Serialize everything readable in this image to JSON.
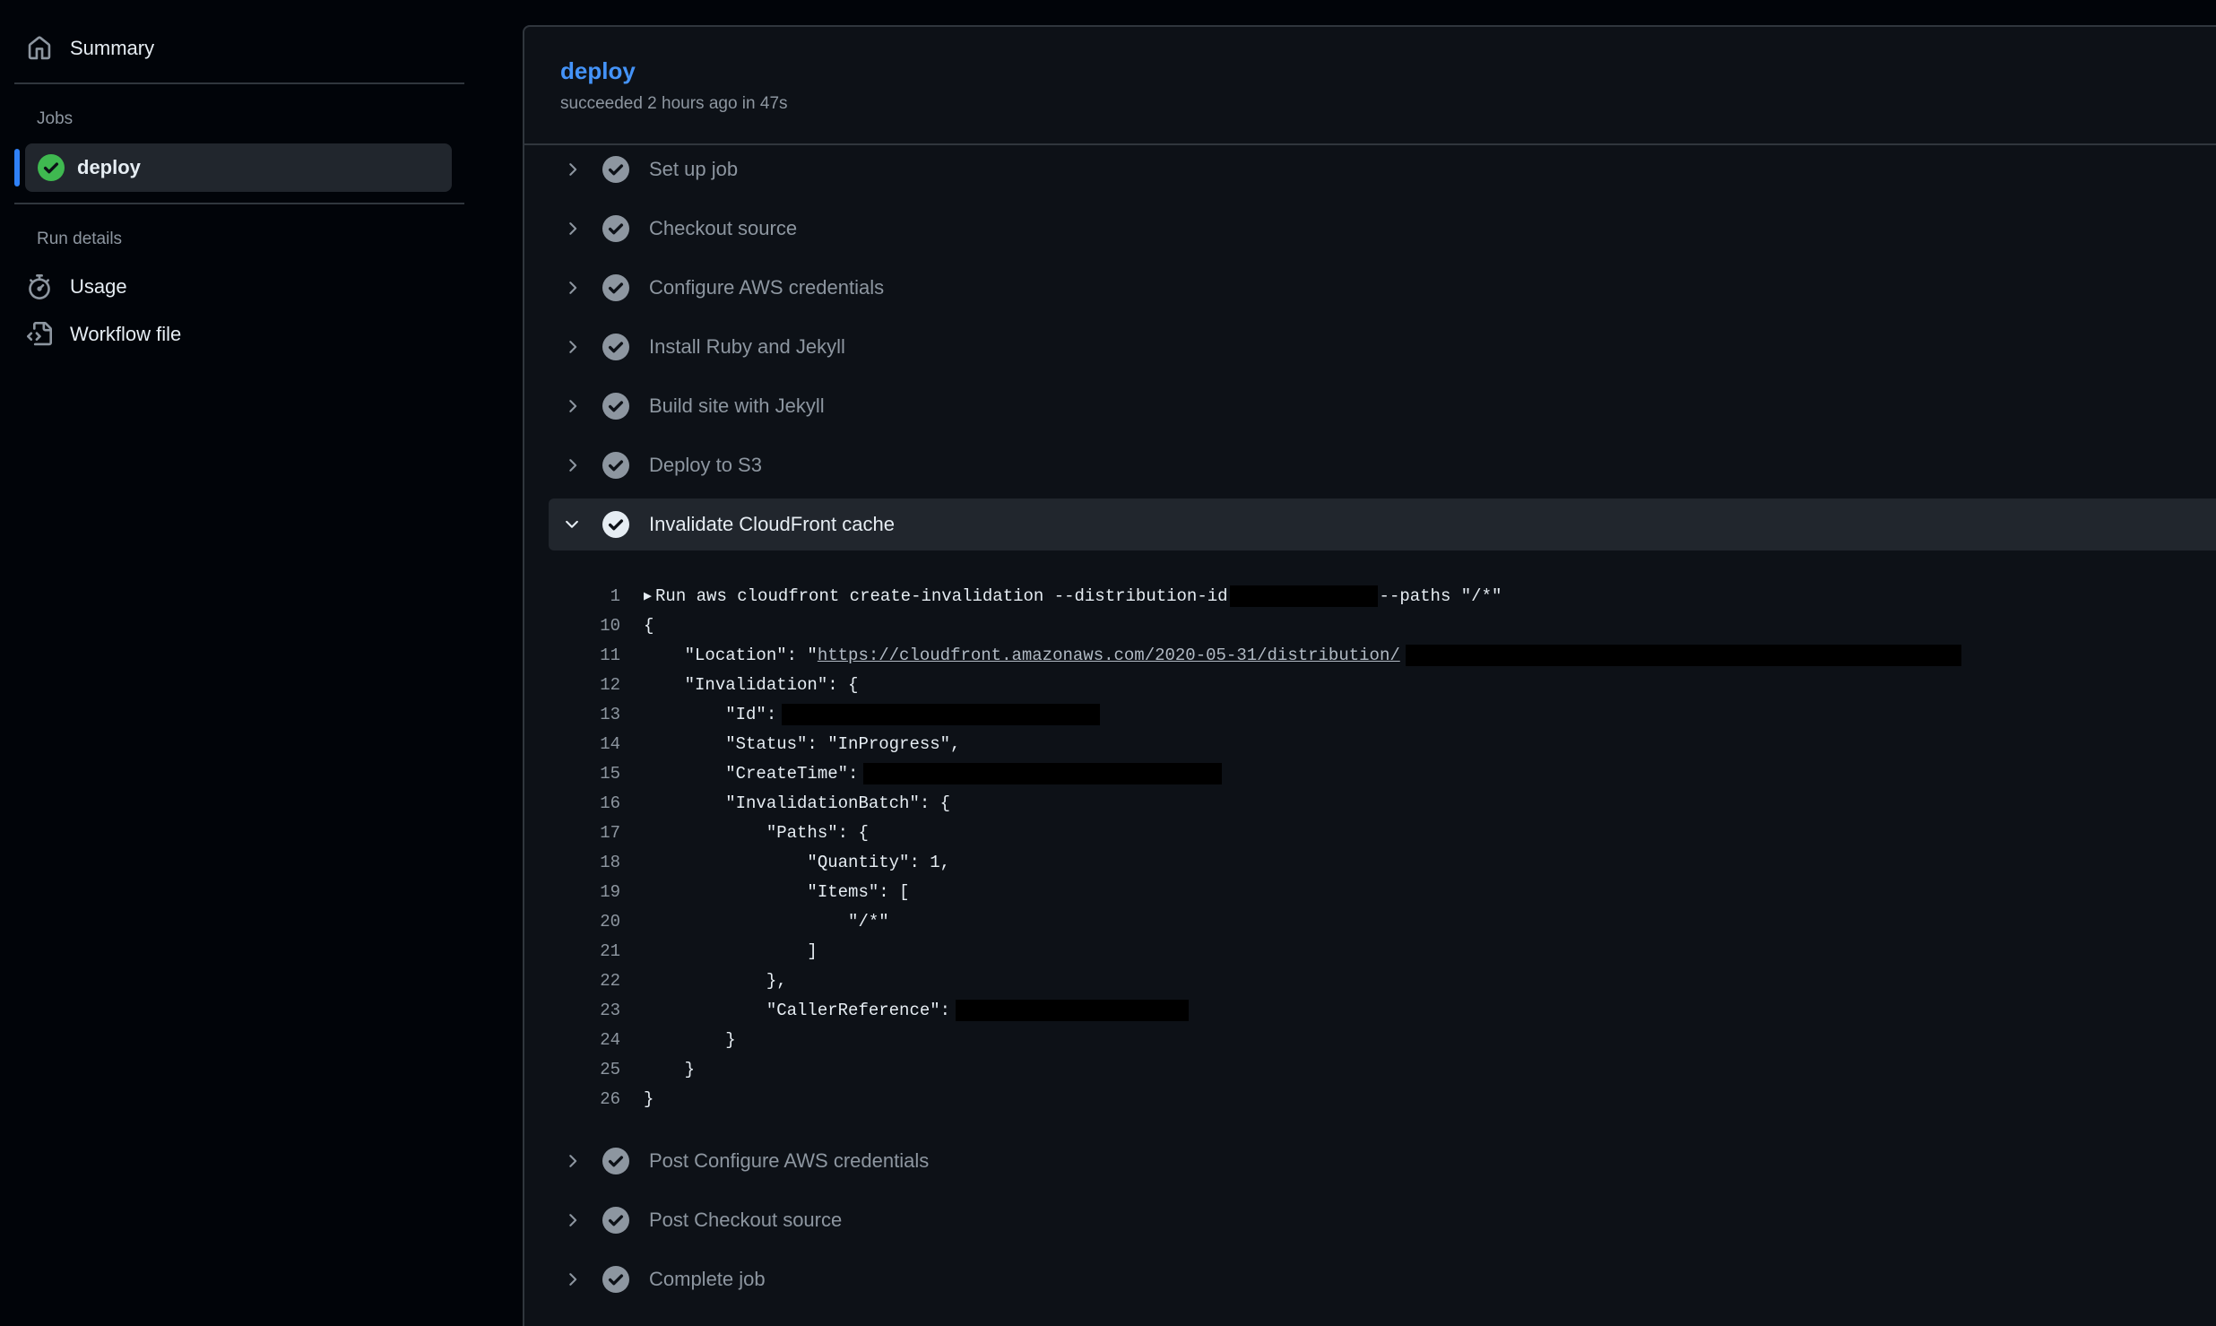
{
  "sidebar": {
    "summary_label": "Summary",
    "jobs_heading": "Jobs",
    "active_job_label": "deploy",
    "run_details_heading": "Run details",
    "usage_label": "Usage",
    "workflow_file_label": "Workflow file"
  },
  "job": {
    "title": "deploy",
    "meta": "succeeded 2 hours ago in 47s"
  },
  "steps": [
    {
      "label": "Set up job",
      "expanded": false
    },
    {
      "label": "Checkout source",
      "expanded": false
    },
    {
      "label": "Configure AWS credentials",
      "expanded": false
    },
    {
      "label": "Install Ruby and Jekyll",
      "expanded": false
    },
    {
      "label": "Build site with Jekyll",
      "expanded": false
    },
    {
      "label": "Deploy to S3",
      "expanded": false
    },
    {
      "label": "Invalidate CloudFront cache",
      "expanded": true
    },
    {
      "label": "Post Configure AWS credentials",
      "expanded": false
    },
    {
      "label": "Post Checkout source",
      "expanded": false
    },
    {
      "label": "Complete job",
      "expanded": false
    }
  ],
  "log": {
    "run_line": {
      "num": "1",
      "cmd": "Run aws cloudfront create-invalidation --distribution-id",
      "suffix": "--paths \"/*\""
    },
    "lines": [
      {
        "num": "10",
        "text": "{"
      },
      {
        "num": "11",
        "text": "    \"Location\": \"",
        "url": "https://cloudfront.amazonaws.com/2020-05-31/distribution/"
      },
      {
        "num": "12",
        "text": "    \"Invalidation\": {"
      },
      {
        "num": "13",
        "text": "        \"Id\":"
      },
      {
        "num": "14",
        "text": "        \"Status\": \"InProgress\","
      },
      {
        "num": "15",
        "text": "        \"CreateTime\":"
      },
      {
        "num": "16",
        "text": "        \"InvalidationBatch\": {"
      },
      {
        "num": "17",
        "text": "            \"Paths\": {"
      },
      {
        "num": "18",
        "text": "                \"Quantity\": 1,"
      },
      {
        "num": "19",
        "text": "                \"Items\": ["
      },
      {
        "num": "20",
        "text": "                    \"/*\""
      },
      {
        "num": "21",
        "text": "                ]"
      },
      {
        "num": "22",
        "text": "            },"
      },
      {
        "num": "23",
        "text": "            \"CallerReference\":"
      },
      {
        "num": "24",
        "text": "        }"
      },
      {
        "num": "25",
        "text": "    }"
      },
      {
        "num": "26",
        "text": "}"
      }
    ]
  },
  "colors": {
    "success": "#3fb950",
    "link": "#4493f8",
    "step_check": "#8d96a0"
  },
  "icons": [
    "home-icon",
    "check-circle-fill-icon",
    "stopwatch-icon",
    "file-code-icon",
    "chevron-right-icon",
    "chevron-down-icon",
    "check-circle-icon"
  ]
}
